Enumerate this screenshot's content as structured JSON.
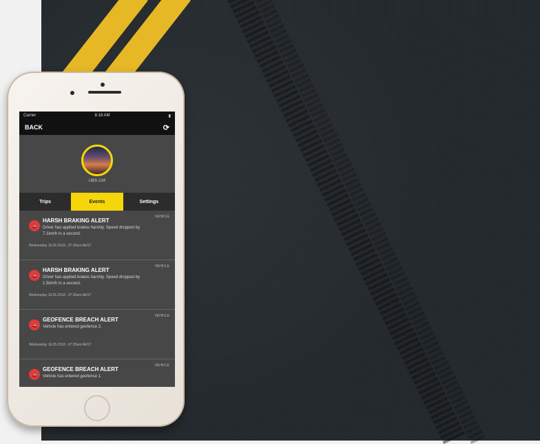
{
  "app": {
    "status_bar": {
      "carrier": "Carrier",
      "time": "8:18 AM"
    },
    "nav": {
      "back_label": "BACK",
      "refresh_icon": "refresh-icon"
    },
    "profile": {
      "vehicle_id": "UBS-134"
    },
    "tabs": [
      {
        "label": "Trips"
      },
      {
        "label": "Events"
      },
      {
        "label": "Settings"
      }
    ],
    "alerts": [
      {
        "title": "HARSH BRAKING ALERT",
        "description": "Driver has applied brakes harshly. Speed dropped by 7.1km/h in a second.",
        "vehicle": "VEHICLE",
        "datetime": "Wednesday 16.05.2018 , 07:35am AEST"
      },
      {
        "title": "HARSH BRAKING ALERT",
        "description": "Driver has applied brakes harshly. Speed dropped by 1.5km/h in a second.",
        "vehicle": "VEHICLE",
        "datetime": "Wednesday 16.05.2018 , 07:30am AEST"
      },
      {
        "title": "GEOFENCE BREACH ALERT",
        "description": "Vehicle has entered geofence 2.",
        "vehicle": "VEHICLE",
        "datetime": "Wednesday 16.05.2018 , 07:25am AEST"
      },
      {
        "title": "GEOFENCE BREACH ALERT",
        "description": "Vehicle has entered geofence 1.",
        "vehicle": "VEHICLE",
        "datetime": ""
      }
    ],
    "colors": {
      "accent": "#f5d60a",
      "alert": "#e13a3a",
      "road_line": "#e6b826"
    }
  }
}
